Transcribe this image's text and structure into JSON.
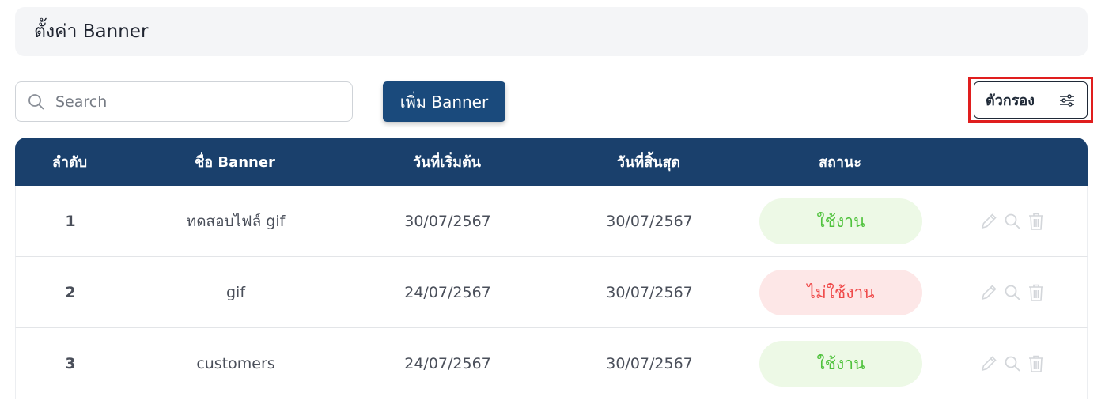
{
  "header": {
    "title": "ตั้งค่า Banner"
  },
  "toolbar": {
    "search_placeholder": "Search",
    "add_button_label": "เพิ่ม Banner",
    "filter_button_label": "ตัวกรอง"
  },
  "table": {
    "columns": {
      "no": "ลำดับ",
      "name": "ชื่อ Banner",
      "start": "วันที่เริ่มต้น",
      "end": "วันที่สิ้นสุด",
      "status": "สถานะ"
    },
    "rows": [
      {
        "no": "1",
        "name": "ทดสอบไฟล์ gif",
        "start": "30/07/2567",
        "end": "30/07/2567",
        "status": "ใช้งาน"
      },
      {
        "no": "2",
        "name": "gif",
        "start": "24/07/2567",
        "end": "30/07/2567",
        "status": "ไม่ใช้งาน"
      },
      {
        "no": "3",
        "name": "customers",
        "start": "24/07/2567",
        "end": "30/07/2567",
        "status": "ใช้งาน"
      }
    ]
  },
  "colors": {
    "header_bg": "#1a406c",
    "primary_button": "#1a4a7c",
    "active_text": "#4fc23c",
    "active_bg": "#edf9e6",
    "inactive_text": "#ef4b4b",
    "inactive_bg": "#fde7e7",
    "highlight": "#e01e1e"
  },
  "icons": {
    "search": "search-icon",
    "filter": "sliders-icon",
    "row_actions": [
      "pencil-icon",
      "magnifier-icon",
      "trash-icon"
    ]
  }
}
